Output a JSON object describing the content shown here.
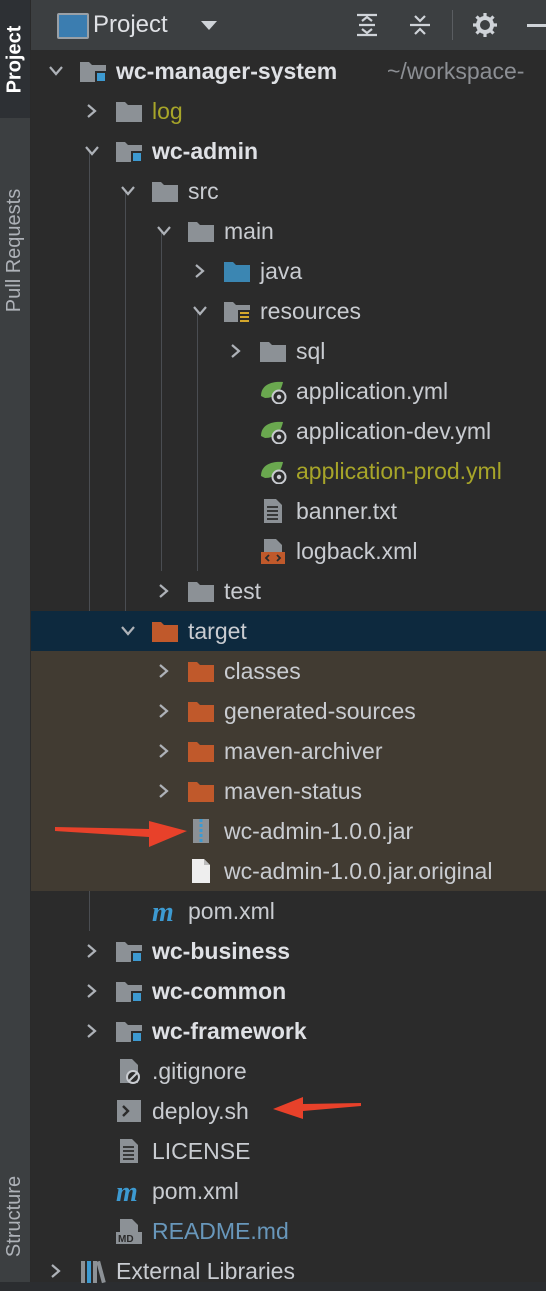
{
  "sidebar": {
    "tabs": [
      {
        "label": "Project",
        "active": true
      },
      {
        "label": "Pull Requests",
        "active": false
      },
      {
        "label": "Structure",
        "active": false
      }
    ]
  },
  "header": {
    "title": "Project",
    "icons": [
      "expand-all-icon",
      "collapse-all-icon",
      "gear-icon",
      "minimize-icon"
    ]
  },
  "tree": {
    "root_name": "wc-manager-system",
    "root_path": "~/workspace-",
    "items": [
      {
        "label": "log",
        "icon": "folder-icon"
      },
      {
        "label": "wc-admin",
        "icon": "module-folder-icon"
      },
      {
        "label": "src",
        "icon": "folder-icon"
      },
      {
        "label": "main",
        "icon": "folder-icon"
      },
      {
        "label": "java",
        "icon": "source-folder-icon"
      },
      {
        "label": "resources",
        "icon": "resources-folder-icon"
      },
      {
        "label": "sql",
        "icon": "folder-icon"
      },
      {
        "label": "application.yml",
        "icon": "spring-config-icon"
      },
      {
        "label": "application-dev.yml",
        "icon": "spring-config-icon"
      },
      {
        "label": "application-prod.yml",
        "icon": "spring-config-icon"
      },
      {
        "label": "banner.txt",
        "icon": "text-file-icon"
      },
      {
        "label": "logback.xml",
        "icon": "xml-file-icon"
      },
      {
        "label": "test",
        "icon": "folder-icon"
      },
      {
        "label": "target",
        "icon": "excluded-folder-icon"
      },
      {
        "label": "classes",
        "icon": "excluded-folder-icon"
      },
      {
        "label": "generated-sources",
        "icon": "excluded-folder-icon"
      },
      {
        "label": "maven-archiver",
        "icon": "excluded-folder-icon"
      },
      {
        "label": "maven-status",
        "icon": "excluded-folder-icon"
      },
      {
        "label": "wc-admin-1.0.0.jar",
        "icon": "jar-file-icon"
      },
      {
        "label": "wc-admin-1.0.0.jar.original",
        "icon": "file-icon"
      },
      {
        "label": "pom.xml",
        "icon": "maven-icon"
      },
      {
        "label": "wc-business",
        "icon": "module-folder-icon"
      },
      {
        "label": "wc-common",
        "icon": "module-folder-icon"
      },
      {
        "label": "wc-framework",
        "icon": "module-folder-icon"
      },
      {
        "label": ".gitignore",
        "icon": "ignored-file-icon"
      },
      {
        "label": "deploy.sh",
        "icon": "shell-script-icon"
      },
      {
        "label": "LICENSE",
        "icon": "text-file-icon"
      },
      {
        "label": "pom.xml",
        "icon": "maven-icon"
      },
      {
        "label": "README.md",
        "icon": "markdown-file-icon"
      },
      {
        "label": "External Libraries",
        "icon": "libraries-icon"
      }
    ]
  },
  "colors": {
    "background": "#2b2b2b",
    "selection": "#0d293e",
    "excluded_bg": "#413b32",
    "excluded_folder": "#c0592b",
    "folder": "#8c9196",
    "module_marker": "#3d9ad1",
    "source_folder": "#3b86b2",
    "spring_green": "#6aa84f",
    "olive_text": "#a7a529",
    "md_text": "#6897bb",
    "annotation_arrow": "#e8412a"
  }
}
